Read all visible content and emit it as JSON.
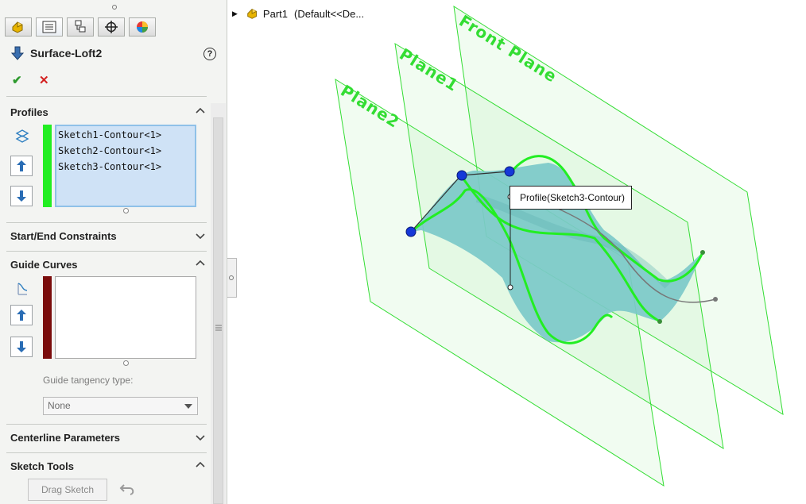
{
  "tabs": [
    {
      "icon": "feature-manager-icon"
    },
    {
      "icon": "property-manager-icon"
    },
    {
      "icon": "configuration-manager-icon"
    },
    {
      "icon": "dimxpert-manager-icon"
    },
    {
      "icon": "display-manager-icon"
    }
  ],
  "feature": {
    "title": "Surface-Loft2",
    "icon": "surface-loft-icon",
    "help": "?"
  },
  "actions": {
    "ok": "✔",
    "cancel": "✕"
  },
  "sections": {
    "profiles": {
      "header": "Profiles",
      "items": [
        "Sketch1-Contour<1>",
        "Sketch2-Contour<1>",
        "Sketch3-Contour<1>"
      ],
      "color": "#22ee22"
    },
    "start_end": {
      "header": "Start/End Constraints"
    },
    "guide_curves": {
      "header": "Guide Curves",
      "color": "#7a0c0c",
      "tangency_label": "Guide tangency type:",
      "tangency_value": "None"
    },
    "centerline": {
      "header": "Centerline Parameters"
    },
    "sketch_tools": {
      "header": "Sketch Tools",
      "drag_button": "Drag Sketch"
    }
  },
  "tree": {
    "part": "Part1",
    "config": "(Default<<De..."
  },
  "viewport": {
    "planes": [
      "Front Plane",
      "Plane1",
      "Plane2"
    ],
    "callout": "Profile(Sketch3-Contour)",
    "plane_color": "#33dd33",
    "surface_color": "#7cc9c9"
  }
}
